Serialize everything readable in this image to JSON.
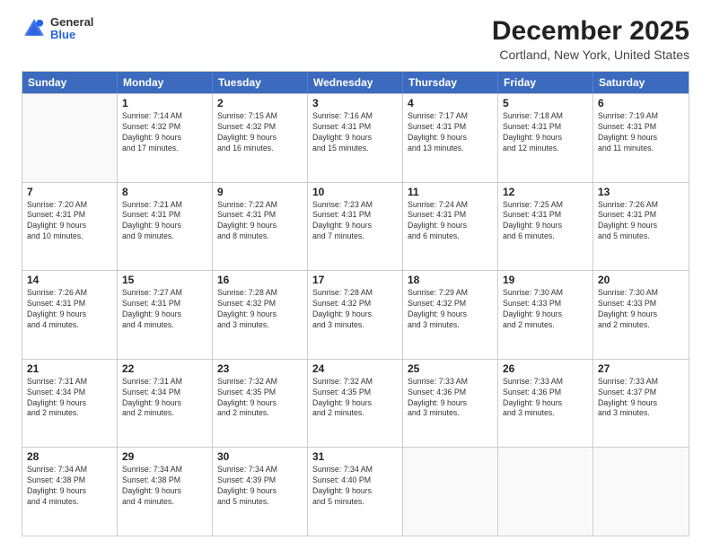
{
  "header": {
    "logo": {
      "general": "General",
      "blue": "Blue"
    },
    "title": "December 2025",
    "location": "Cortland, New York, United States"
  },
  "calendar": {
    "days_of_week": [
      "Sunday",
      "Monday",
      "Tuesday",
      "Wednesday",
      "Thursday",
      "Friday",
      "Saturday"
    ],
    "rows": [
      [
        {
          "day": "",
          "empty": true,
          "lines": []
        },
        {
          "day": "1",
          "empty": false,
          "lines": [
            "Sunrise: 7:14 AM",
            "Sunset: 4:32 PM",
            "Daylight: 9 hours",
            "and 17 minutes."
          ]
        },
        {
          "day": "2",
          "empty": false,
          "lines": [
            "Sunrise: 7:15 AM",
            "Sunset: 4:32 PM",
            "Daylight: 9 hours",
            "and 16 minutes."
          ]
        },
        {
          "day": "3",
          "empty": false,
          "lines": [
            "Sunrise: 7:16 AM",
            "Sunset: 4:31 PM",
            "Daylight: 9 hours",
            "and 15 minutes."
          ]
        },
        {
          "day": "4",
          "empty": false,
          "lines": [
            "Sunrise: 7:17 AM",
            "Sunset: 4:31 PM",
            "Daylight: 9 hours",
            "and 13 minutes."
          ]
        },
        {
          "day": "5",
          "empty": false,
          "lines": [
            "Sunrise: 7:18 AM",
            "Sunset: 4:31 PM",
            "Daylight: 9 hours",
            "and 12 minutes."
          ]
        },
        {
          "day": "6",
          "empty": false,
          "lines": [
            "Sunrise: 7:19 AM",
            "Sunset: 4:31 PM",
            "Daylight: 9 hours",
            "and 11 minutes."
          ]
        }
      ],
      [
        {
          "day": "7",
          "empty": false,
          "lines": [
            "Sunrise: 7:20 AM",
            "Sunset: 4:31 PM",
            "Daylight: 9 hours",
            "and 10 minutes."
          ]
        },
        {
          "day": "8",
          "empty": false,
          "lines": [
            "Sunrise: 7:21 AM",
            "Sunset: 4:31 PM",
            "Daylight: 9 hours",
            "and 9 minutes."
          ]
        },
        {
          "day": "9",
          "empty": false,
          "lines": [
            "Sunrise: 7:22 AM",
            "Sunset: 4:31 PM",
            "Daylight: 9 hours",
            "and 8 minutes."
          ]
        },
        {
          "day": "10",
          "empty": false,
          "lines": [
            "Sunrise: 7:23 AM",
            "Sunset: 4:31 PM",
            "Daylight: 9 hours",
            "and 7 minutes."
          ]
        },
        {
          "day": "11",
          "empty": false,
          "lines": [
            "Sunrise: 7:24 AM",
            "Sunset: 4:31 PM",
            "Daylight: 9 hours",
            "and 6 minutes."
          ]
        },
        {
          "day": "12",
          "empty": false,
          "lines": [
            "Sunrise: 7:25 AM",
            "Sunset: 4:31 PM",
            "Daylight: 9 hours",
            "and 6 minutes."
          ]
        },
        {
          "day": "13",
          "empty": false,
          "lines": [
            "Sunrise: 7:26 AM",
            "Sunset: 4:31 PM",
            "Daylight: 9 hours",
            "and 5 minutes."
          ]
        }
      ],
      [
        {
          "day": "14",
          "empty": false,
          "lines": [
            "Sunrise: 7:26 AM",
            "Sunset: 4:31 PM",
            "Daylight: 9 hours",
            "and 4 minutes."
          ]
        },
        {
          "day": "15",
          "empty": false,
          "lines": [
            "Sunrise: 7:27 AM",
            "Sunset: 4:31 PM",
            "Daylight: 9 hours",
            "and 4 minutes."
          ]
        },
        {
          "day": "16",
          "empty": false,
          "lines": [
            "Sunrise: 7:28 AM",
            "Sunset: 4:32 PM",
            "Daylight: 9 hours",
            "and 3 minutes."
          ]
        },
        {
          "day": "17",
          "empty": false,
          "lines": [
            "Sunrise: 7:28 AM",
            "Sunset: 4:32 PM",
            "Daylight: 9 hours",
            "and 3 minutes."
          ]
        },
        {
          "day": "18",
          "empty": false,
          "lines": [
            "Sunrise: 7:29 AM",
            "Sunset: 4:32 PM",
            "Daylight: 9 hours",
            "and 3 minutes."
          ]
        },
        {
          "day": "19",
          "empty": false,
          "lines": [
            "Sunrise: 7:30 AM",
            "Sunset: 4:33 PM",
            "Daylight: 9 hours",
            "and 2 minutes."
          ]
        },
        {
          "day": "20",
          "empty": false,
          "lines": [
            "Sunrise: 7:30 AM",
            "Sunset: 4:33 PM",
            "Daylight: 9 hours",
            "and 2 minutes."
          ]
        }
      ],
      [
        {
          "day": "21",
          "empty": false,
          "lines": [
            "Sunrise: 7:31 AM",
            "Sunset: 4:34 PM",
            "Daylight: 9 hours",
            "and 2 minutes."
          ]
        },
        {
          "day": "22",
          "empty": false,
          "lines": [
            "Sunrise: 7:31 AM",
            "Sunset: 4:34 PM",
            "Daylight: 9 hours",
            "and 2 minutes."
          ]
        },
        {
          "day": "23",
          "empty": false,
          "lines": [
            "Sunrise: 7:32 AM",
            "Sunset: 4:35 PM",
            "Daylight: 9 hours",
            "and 2 minutes."
          ]
        },
        {
          "day": "24",
          "empty": false,
          "lines": [
            "Sunrise: 7:32 AM",
            "Sunset: 4:35 PM",
            "Daylight: 9 hours",
            "and 2 minutes."
          ]
        },
        {
          "day": "25",
          "empty": false,
          "lines": [
            "Sunrise: 7:33 AM",
            "Sunset: 4:36 PM",
            "Daylight: 9 hours",
            "and 3 minutes."
          ]
        },
        {
          "day": "26",
          "empty": false,
          "lines": [
            "Sunrise: 7:33 AM",
            "Sunset: 4:36 PM",
            "Daylight: 9 hours",
            "and 3 minutes."
          ]
        },
        {
          "day": "27",
          "empty": false,
          "lines": [
            "Sunrise: 7:33 AM",
            "Sunset: 4:37 PM",
            "Daylight: 9 hours",
            "and 3 minutes."
          ]
        }
      ],
      [
        {
          "day": "28",
          "empty": false,
          "lines": [
            "Sunrise: 7:34 AM",
            "Sunset: 4:38 PM",
            "Daylight: 9 hours",
            "and 4 minutes."
          ]
        },
        {
          "day": "29",
          "empty": false,
          "lines": [
            "Sunrise: 7:34 AM",
            "Sunset: 4:38 PM",
            "Daylight: 9 hours",
            "and 4 minutes."
          ]
        },
        {
          "day": "30",
          "empty": false,
          "lines": [
            "Sunrise: 7:34 AM",
            "Sunset: 4:39 PM",
            "Daylight: 9 hours",
            "and 5 minutes."
          ]
        },
        {
          "day": "31",
          "empty": false,
          "lines": [
            "Sunrise: 7:34 AM",
            "Sunset: 4:40 PM",
            "Daylight: 9 hours",
            "and 5 minutes."
          ]
        },
        {
          "day": "",
          "empty": true,
          "lines": []
        },
        {
          "day": "",
          "empty": true,
          "lines": []
        },
        {
          "day": "",
          "empty": true,
          "lines": []
        }
      ]
    ]
  }
}
